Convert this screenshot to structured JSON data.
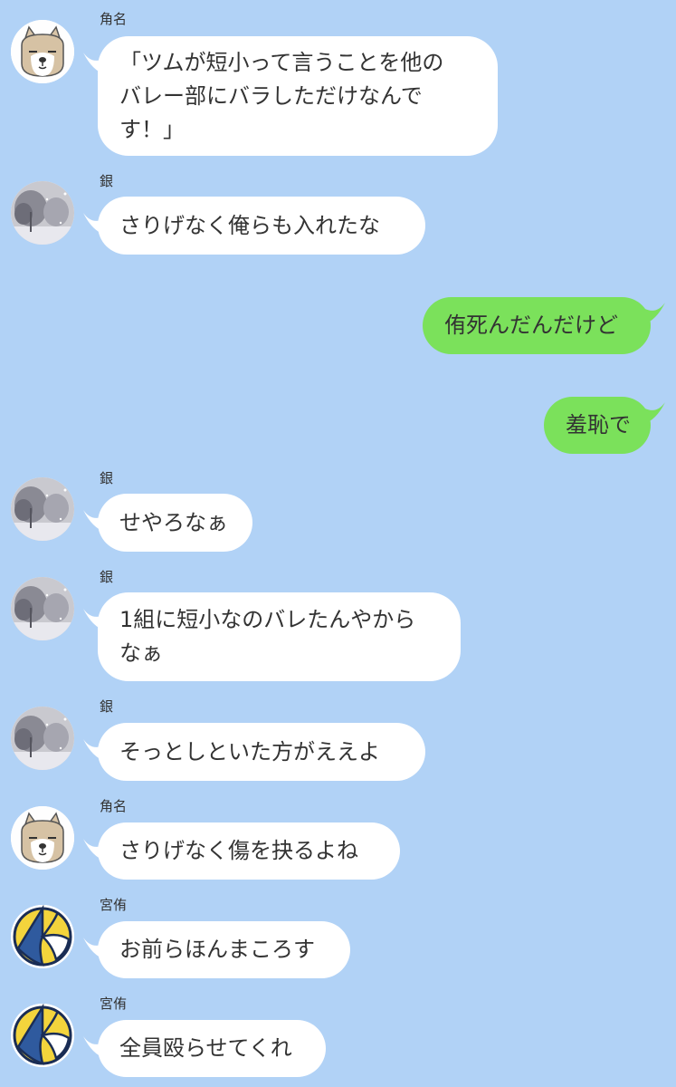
{
  "colors": {
    "background": "#b1d2f6",
    "incoming_bubble": "#ffffff",
    "outgoing_bubble": "#7be15b",
    "text": "#333333"
  },
  "messages": [
    {
      "sender": "角名",
      "avatar": "shiba-dog-icon",
      "text": "「ツムが短小って言うことを他の\nバレー部にバラしただけなんで\nす！」"
    },
    {
      "sender": "銀",
      "avatar": "snowy-tree-icon",
      "text": "さりげなく俺らも入れたな"
    },
    {
      "outgoing": true,
      "text": "侑死んだんだけど"
    },
    {
      "outgoing": true,
      "text": "羞恥で"
    },
    {
      "sender": "銀",
      "avatar": "snowy-tree-icon",
      "text": "せやろなぁ"
    },
    {
      "sender": "銀",
      "avatar": "snowy-tree-icon",
      "text": "1組に短小なのバレたんやから\nなぁ"
    },
    {
      "sender": "銀",
      "avatar": "snowy-tree-icon",
      "text": "そっとしといた方がええよ"
    },
    {
      "sender": "角名",
      "avatar": "shiba-dog-icon",
      "text": "さりげなく傷を抉るよね"
    },
    {
      "sender": "宮侑",
      "avatar": "volleyball-icon",
      "text": "お前らほんまころす"
    },
    {
      "sender": "宮侑",
      "avatar": "volleyball-icon",
      "text": "全員殴らせてくれ"
    }
  ]
}
